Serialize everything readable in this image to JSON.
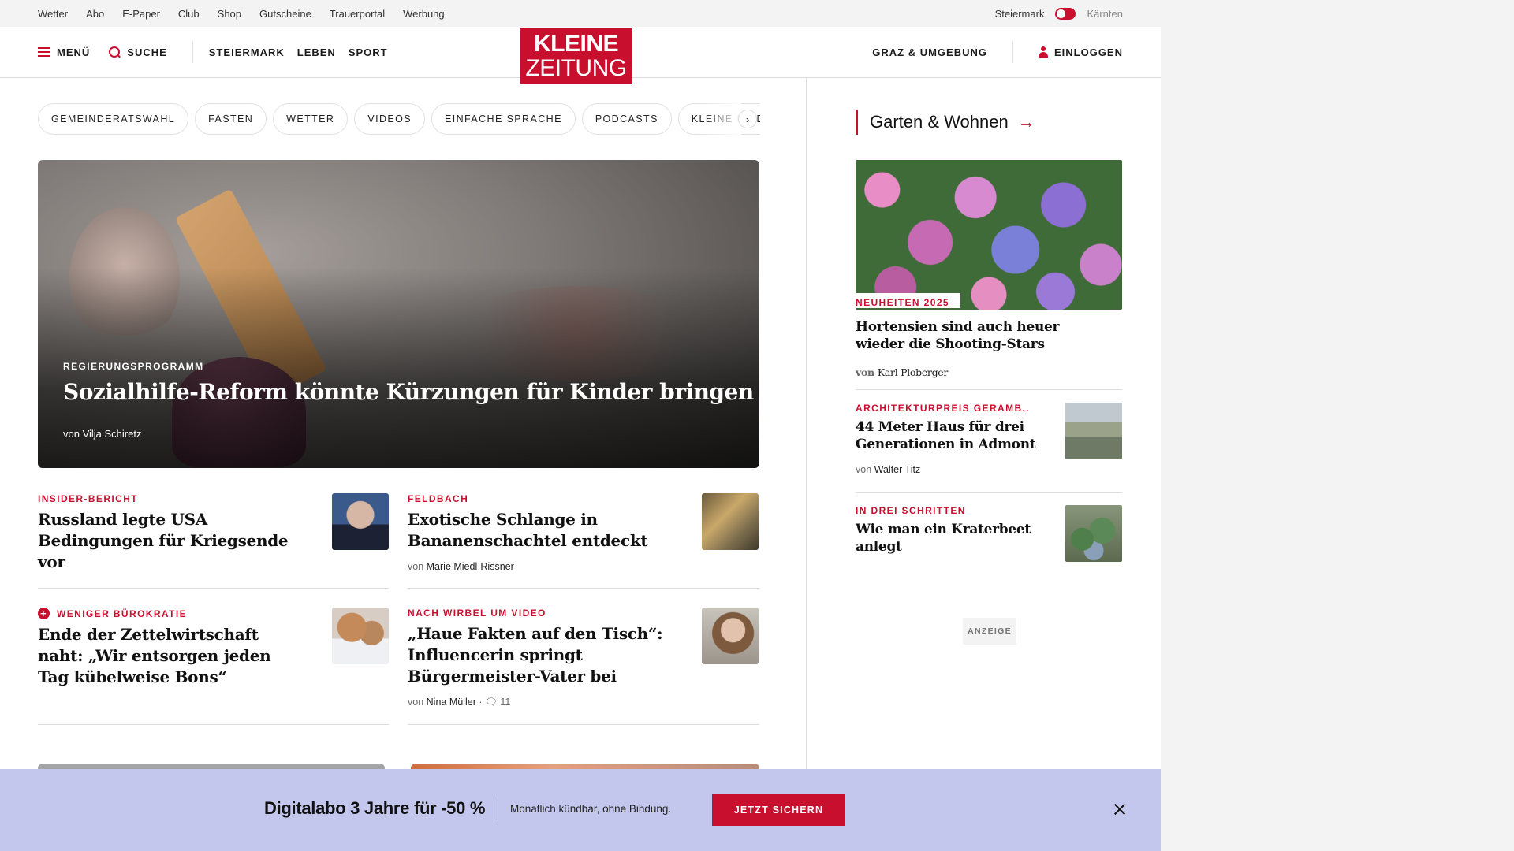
{
  "topbar": {
    "links": [
      "Wetter",
      "Abo",
      "E-Paper",
      "Club",
      "Shop",
      "Gutscheine",
      "Trauerportal",
      "Werbung"
    ],
    "region_active": "Steiermark",
    "region_inactive": "Kärnten"
  },
  "header": {
    "menu_label": "MENÜ",
    "search_label": "SUCHE",
    "nav": [
      "STEIERMARK",
      "LEBEN",
      "SPORT"
    ],
    "logo_line1": "KLEINE",
    "logo_line2": "ZEITUNG",
    "region_link": "GRAZ & UMGEBUNG",
    "login_label": "EINLOGGEN"
  },
  "pills": [
    "GEMEINDERATSWAHL",
    "FASTEN",
    "WETTER",
    "VIDEOS",
    "EINFACHE SPRACHE",
    "PODCASTS",
    "KLEINE KINDER"
  ],
  "hero": {
    "kicker": "REGIERUNGSPROGRAMM",
    "title": "Sozialhilfe-Reform könnte Kürzungen für Kinder bringen",
    "author": "von Vilja Schiretz"
  },
  "articles": [
    {
      "kicker": "INSIDER-BERICHT",
      "title": "Russland legte USA Bedingungen für Kriegsende vor",
      "author_prefix": "",
      "author": "",
      "extra": ""
    },
    {
      "kicker": "FELDBACH",
      "title": "Exotische Schlange in Bananenschachtel entdeckt",
      "author_prefix": "von",
      "author": "Marie Miedl-Rissner",
      "extra": ""
    },
    {
      "kicker": "WENIGER BÜROKRATIE",
      "title": "Ende der Zettelwirtschaft naht: „Wir entsorgen jeden Tag kübelweise Bons“",
      "author_prefix": "",
      "author": "",
      "extra": ""
    },
    {
      "kicker": "NACH WIRBEL UM VIDEO",
      "title": "„Haue Fakten auf den Tisch“: Influencerin springt Bürgermeister-Vater bei",
      "author_prefix": "von",
      "author": "Nina Müller",
      "extra": "· 🗨 11"
    }
  ],
  "sidebar": {
    "heading": "Garten & Wohnen",
    "heading_arrow": "→",
    "featured": {
      "kicker": "NEUHEITEN 2025",
      "title": "Hortensien sind auch heuer wieder die Shooting-Stars",
      "author_prefix": "von",
      "author": "Karl Ploberger"
    },
    "items": [
      {
        "kicker": "ARCHITEKTURPREIS GERAMB...",
        "title": "44 Meter Haus für drei Generationen in Admont",
        "author_prefix": "von",
        "author": "Walter Titz"
      },
      {
        "kicker": "IN DREI SCHRITTEN",
        "title": "Wie man ein Kraterbeet anlegt",
        "author_prefix": "",
        "author": ""
      }
    ],
    "ad_label": "ANZEIGE"
  },
  "banner": {
    "headline": "Digitalabo 3 Jahre für -50 %",
    "subtext": "Monatlich kündbar, ohne Bindung.",
    "cta": "JETZT SICHERN"
  },
  "colors": {
    "brand_red": "#c8102e",
    "banner_bg": "#c3c7ee",
    "topbar_bg": "#f3f3f3"
  }
}
